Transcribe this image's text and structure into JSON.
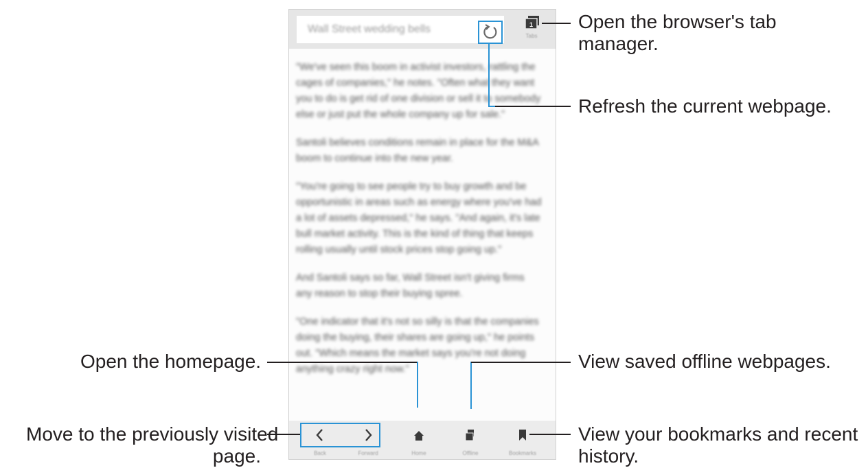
{
  "browser": {
    "url_text": "Wall Street wedding bells",
    "tabs_count": "1",
    "tabs_label": "Tabs",
    "article_paragraphs": [
      "\"We've seen this boom in activist investors, rattling the cages of companies,\" he notes. \"Often what they want you to do is get rid of one division or sell it to somebody else or just put the whole company up for sale.\"",
      "Santoli believes conditions remain in place for the M&A boom to continue into the new year.",
      "\"You're going to see people try to buy growth and be opportunistic in areas such as energy where you've had a lot of assets depressed,\" he says. \"And again, it's late bull market activity. This is the kind of thing that keeps rolling usually until stock prices stop going up.\"",
      "And Santoli says so far, Wall Street isn't giving firms any reason to stop their buying spree.",
      "\"One indicator that it's not so silly is that the companies doing the buying, their shares are going up,\" he points out. \"Which means the market says you're not doing anything crazy right now.\""
    ],
    "bottom_nav": {
      "back_label": "Back",
      "forward_label": "Forward",
      "home_label": "Home",
      "offline_label": "Offline",
      "bookmarks_label": "Bookmarks"
    }
  },
  "callouts": {
    "tab_manager": [
      "Open the browser's tab",
      "manager."
    ],
    "refresh": "Refresh the current webpage.",
    "homepage": "Open the homepage.",
    "offline": "View saved offline webpages.",
    "previous": [
      "Move to the previously visited",
      "page."
    ],
    "bookmarks": [
      "View your bookmarks and recent",
      "history."
    ]
  },
  "colors": {
    "highlight": "#2a93d5",
    "icon": "#3a3a3a",
    "text": "#231f20"
  }
}
